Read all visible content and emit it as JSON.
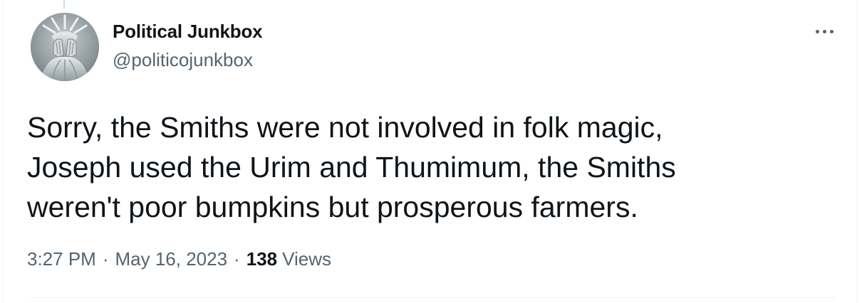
{
  "tweet": {
    "author": {
      "display_name": "Political Junkbox",
      "handle": "@politicojunkbox",
      "avatar_icon": "statue-of-liberty-facepalm-avatar"
    },
    "text": "Sorry, the Smiths were not involved in folk magic,\nJoseph used the Urim and Thumimum, the Smiths\nweren't poor bumpkins but prosperous farmers.",
    "time": "3:27 PM",
    "separator": "·",
    "date": "May 16, 2023",
    "views_count": "138",
    "views_label": "Views",
    "more_icon": "more-horizontal-icon"
  }
}
